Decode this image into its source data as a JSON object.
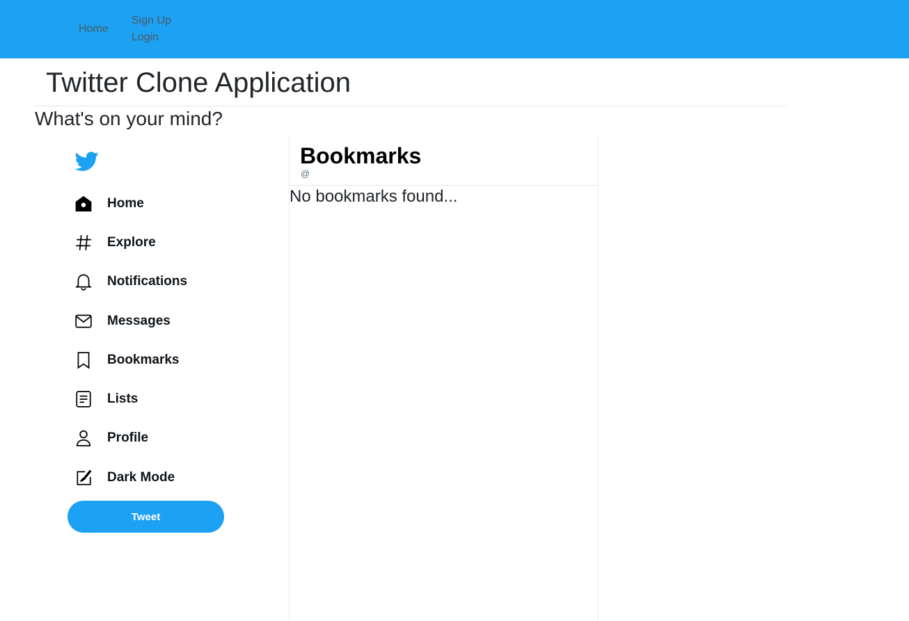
{
  "navbar": {
    "home": "Home",
    "sign_up": "Sign Up",
    "login": "Login",
    "color": "#1da1f2"
  },
  "app_title": "Twitter Clone Application",
  "prompt": "What's on your mind?",
  "sidebar": {
    "logo_icon": "twitter-bird-icon",
    "items": [
      {
        "label": "Home",
        "icon": "home-icon"
      },
      {
        "label": "Explore",
        "icon": "hashtag-icon"
      },
      {
        "label": "Notifications",
        "icon": "bell-icon"
      },
      {
        "label": "Messages",
        "icon": "mail-icon"
      },
      {
        "label": "Bookmarks",
        "icon": "bookmark-icon"
      },
      {
        "label": "Lists",
        "icon": "list-icon"
      },
      {
        "label": "Profile",
        "icon": "user-icon"
      },
      {
        "label": "Dark Mode",
        "icon": "edit-icon"
      }
    ],
    "tweet_button": "Tweet"
  },
  "feed": {
    "title": "Bookmarks",
    "handle": "@",
    "empty_message": "No bookmarks found..."
  }
}
